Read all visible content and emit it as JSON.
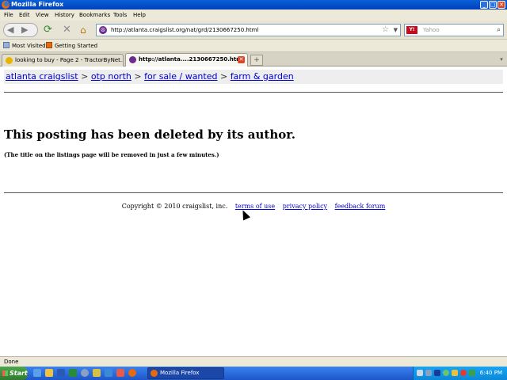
{
  "window": {
    "title": "Mozilla Firefox",
    "minimize": "_",
    "maximize": "□",
    "close": "✕"
  },
  "menu": [
    "File",
    "Edit",
    "View",
    "History",
    "Bookmarks",
    "Tools",
    "Help"
  ],
  "navbar": {
    "url": "http://atlanta.craigslist.org/nat/grd/2130667250.html",
    "search_engine": "Y!",
    "search_placeholder": "Yahoo",
    "back_icon": "back-arrow",
    "forward_icon": "forward-arrow",
    "reload_icon": "reload",
    "stop_icon": "stop",
    "home_icon": "home"
  },
  "bookmarks": [
    {
      "label": "Most Visited"
    },
    {
      "label": "Getting Started"
    }
  ],
  "tabs": [
    {
      "label": "looking to buy - Page 2 - TractorByNet....",
      "active": false
    },
    {
      "label": "http://atlanta....2130667250.html",
      "active": true
    }
  ],
  "content": {
    "breadcrumb": {
      "items": [
        "atlanta craigslist",
        "otp north",
        "for sale / wanted",
        "farm & garden"
      ],
      "separator": ">"
    },
    "heading": "This posting has been deleted by its author.",
    "note": "(The title on the listings page will be removed in just a few minutes.)",
    "footer": {
      "copyright": "Copyright © 2010 craigslist, inc.",
      "links": [
        "terms of use",
        "privacy policy",
        "feedback forum"
      ]
    }
  },
  "status": {
    "text": "Done"
  },
  "taskbar": {
    "start_label": "Start",
    "active_task": "Mozilla Firefox",
    "clock": "6:40 PM"
  },
  "colors": {
    "link": "#0000cc",
    "titlebar": "#0a5fd8",
    "taskbar": "#1f56c8",
    "start": "#3a9a3a"
  }
}
